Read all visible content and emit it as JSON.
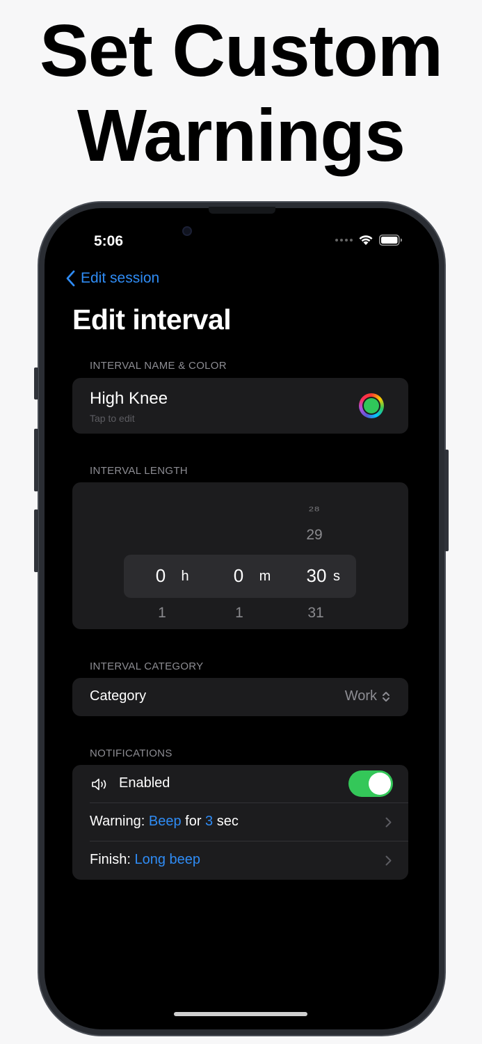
{
  "headline": {
    "line1": "Set Custom",
    "line2": "Warnings"
  },
  "status_bar": {
    "time": "5:06"
  },
  "nav": {
    "back_label": "Edit session",
    "title": "Edit interval"
  },
  "sections": {
    "name_color": "INTERVAL NAME & COLOR",
    "length": "INTERVAL LENGTH",
    "category": "INTERVAL CATEGORY",
    "notifications": "NOTIFICATIONS"
  },
  "interval": {
    "name": "High Knee",
    "hint": "Tap to edit",
    "color": "#30c75a"
  },
  "picker": {
    "hours": {
      "selected": "0",
      "unit": "h",
      "next": "1"
    },
    "minutes": {
      "selected": "0",
      "unit": "m",
      "next": "1"
    },
    "seconds": {
      "prev2": "28",
      "prev1": "29",
      "selected": "30",
      "unit": "s",
      "next": "31"
    }
  },
  "category": {
    "label": "Category",
    "value": "Work"
  },
  "notifications": {
    "enabled_label": "Enabled",
    "enabled": true,
    "warning_prefix": "Warning:",
    "warning_sound": "Beep",
    "warning_for": "for",
    "warning_seconds": "3",
    "warning_unit": "sec",
    "finish_prefix": "Finish:",
    "finish_sound": "Long beep"
  },
  "colors": {
    "accent": "#2f8cf5",
    "toggle_on": "#34c759"
  }
}
